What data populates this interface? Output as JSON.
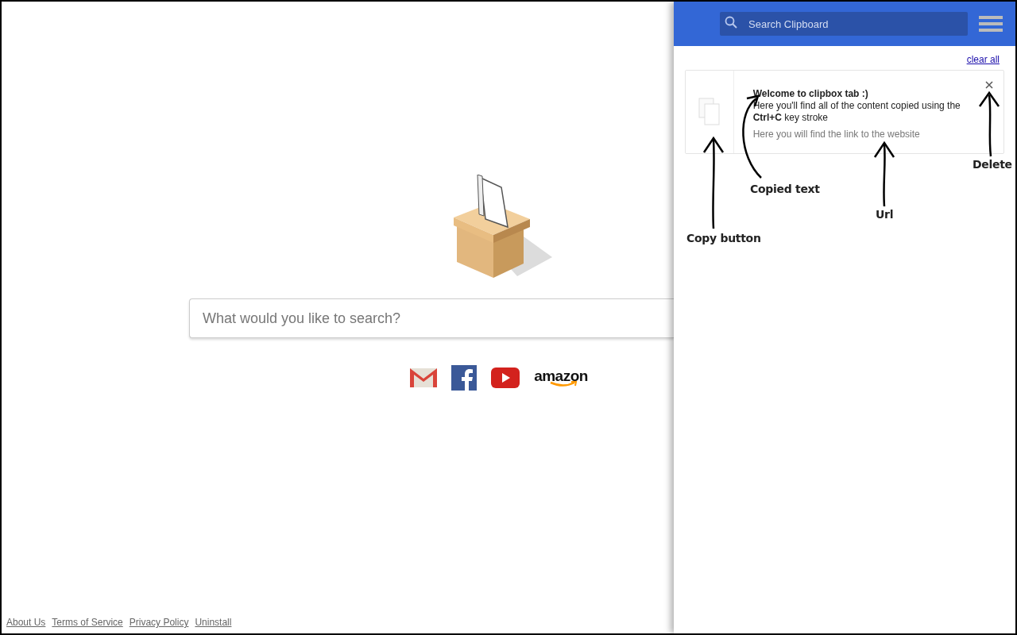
{
  "main": {
    "search": {
      "placeholder": "What would you like to search?"
    },
    "shortcuts": [
      {
        "kind": "gmail"
      },
      {
        "kind": "facebook"
      },
      {
        "kind": "youtube"
      },
      {
        "kind": "amazon",
        "label": "amazon"
      }
    ]
  },
  "footer": {
    "links": [
      "About Us",
      "Terms of Service",
      "Privacy Policy",
      "Uninstall"
    ]
  },
  "clipboard_panel": {
    "search": {
      "placeholder": "Search Clipboard"
    },
    "clear_all": "clear all",
    "items": [
      {
        "title": "Welcome to clipbox tab :)",
        "text": "Here you'll find all of the content copied using the **Ctrl+C** key stroke",
        "url": "Here you will find the link to the website"
      }
    ],
    "annotations": [
      {
        "label": "Copy button"
      },
      {
        "label": "Copied text"
      },
      {
        "label": "Url"
      },
      {
        "label": "Delete"
      }
    ]
  }
}
